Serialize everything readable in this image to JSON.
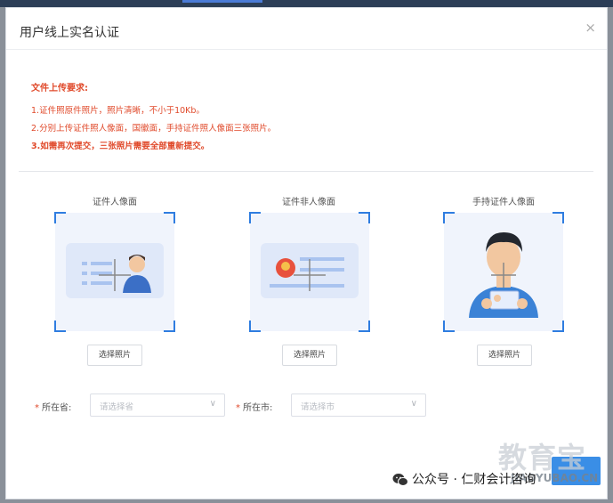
{
  "dialog": {
    "title": "用户线上实名认证",
    "close_glyph": "×"
  },
  "requirements": {
    "title": "文件上传要求:",
    "line1": "1.证件照原件照片，照片清晰，不小于10Kb。",
    "line2": "2.分别上传证件照人像面，国徽面，手持证件照人像面三张照片。",
    "line3": "3.如需再次提交，三张照片需要全部重新提交。"
  },
  "uploads": [
    {
      "label": "证件人像面",
      "button": "选择照片",
      "icon": "id-card-portrait-icon"
    },
    {
      "label": "证件非人像面",
      "button": "选择照片",
      "icon": "id-card-emblem-icon"
    },
    {
      "label": "手持证件人像面",
      "button": "选择照片",
      "icon": "person-holding-id-icon"
    }
  ],
  "form": {
    "province": {
      "label": "所在省:",
      "placeholder": "请选择省"
    },
    "city": {
      "label": "所在市:",
      "placeholder": "请选择市"
    },
    "required_mark": "*",
    "chevron": "∨"
  },
  "overlay": {
    "watermark": "教育宝",
    "watermark_small": "JIAOYUBAO.CN",
    "wechat_text": "公众号 · 仁财会计咨询"
  },
  "colors": {
    "accent": "#2f7de0",
    "warning": "#e04a2b",
    "card_bg": "#f0f4fc"
  }
}
